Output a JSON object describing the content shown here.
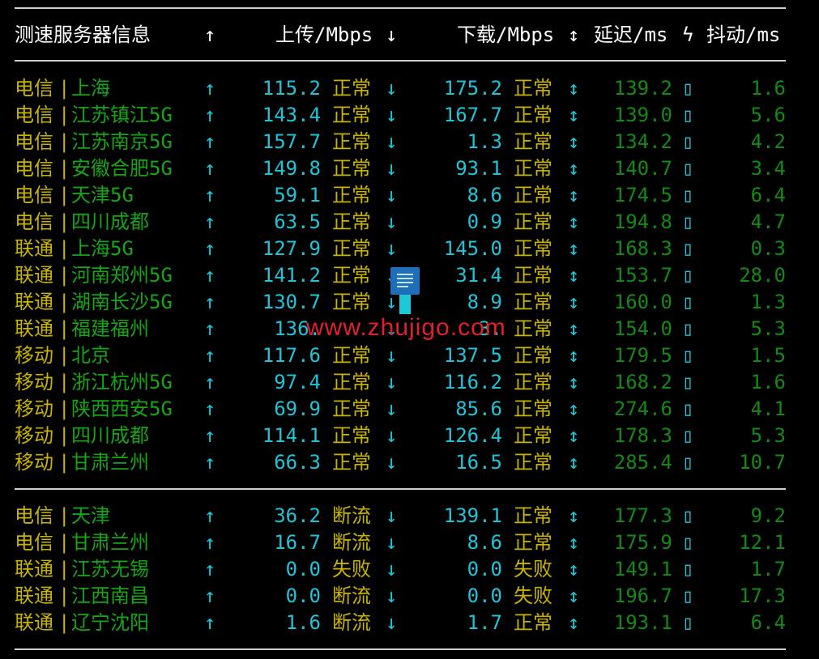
{
  "header": {
    "name": "测速服务器信息",
    "up_arrow": "↑",
    "up": "上传/Mbps",
    "down_arrow": "↓",
    "down": "下载/Mbps",
    "lat_arrow": "↕",
    "latency": "延迟/ms",
    "jitter_icon": "ϟ",
    "jitter": "抖动/ms"
  },
  "icons": {
    "up": "↑",
    "down": "↓",
    "updown": "↕",
    "jitter_box": "▯",
    "pipe": "|"
  },
  "colors": {
    "isp": "#c8b400",
    "location": "#15a515",
    "cyan": "#20c4d8",
    "green_num": "#138a13",
    "watermark": "#e0202a"
  },
  "group1": [
    {
      "isp": "电信",
      "loc": "上海",
      "up": "115.2",
      "up_status": "正常",
      "down": "175.2",
      "down_status": "正常",
      "latency": "139.2",
      "jitter": "1.6"
    },
    {
      "isp": "电信",
      "loc": "江苏镇江5G",
      "up": "143.4",
      "up_status": "正常",
      "down": "167.7",
      "down_status": "正常",
      "latency": "139.0",
      "jitter": "5.6"
    },
    {
      "isp": "电信",
      "loc": "江苏南京5G",
      "up": "157.7",
      "up_status": "正常",
      "down": "1.3",
      "down_status": "正常",
      "latency": "134.2",
      "jitter": "4.2"
    },
    {
      "isp": "电信",
      "loc": "安徽合肥5G",
      "up": "149.8",
      "up_status": "正常",
      "down": "93.1",
      "down_status": "正常",
      "latency": "140.7",
      "jitter": "3.4"
    },
    {
      "isp": "电信",
      "loc": "天津5G",
      "up": "59.1",
      "up_status": "正常",
      "down": "8.6",
      "down_status": "正常",
      "latency": "174.5",
      "jitter": "6.4"
    },
    {
      "isp": "电信",
      "loc": "四川成都",
      "up": "63.5",
      "up_status": "正常",
      "down": "0.9",
      "down_status": "正常",
      "latency": "194.8",
      "jitter": "4.7"
    },
    {
      "isp": "联通",
      "loc": "上海5G",
      "up": "127.9",
      "up_status": "正常",
      "down": "145.0",
      "down_status": "正常",
      "latency": "168.3",
      "jitter": "0.3"
    },
    {
      "isp": "联通",
      "loc": "河南郑州5G",
      "up": "141.2",
      "up_status": "正常",
      "down": "31.4",
      "down_status": "正常",
      "latency": "153.7",
      "jitter": "28.0"
    },
    {
      "isp": "联通",
      "loc": "湖南长沙5G",
      "up": "130.7",
      "up_status": "正常",
      "down": "8.9",
      "down_status": "正常",
      "latency": "160.0",
      "jitter": "1.3"
    },
    {
      "isp": "联通",
      "loc": "福建福州",
      "up": "136.",
      "up_status": "",
      "down": "3.",
      "down_status": "正常",
      "latency": "154.0",
      "jitter": "5.3"
    },
    {
      "isp": "移动",
      "loc": "北京",
      "up": "117.6",
      "up_status": "正常",
      "down": "137.5",
      "down_status": "正常",
      "latency": "179.5",
      "jitter": "1.5"
    },
    {
      "isp": "移动",
      "loc": "浙江杭州5G",
      "up": "97.4",
      "up_status": "正常",
      "down": "116.2",
      "down_status": "正常",
      "latency": "168.2",
      "jitter": "1.6"
    },
    {
      "isp": "移动",
      "loc": "陕西西安5G",
      "up": "69.9",
      "up_status": "正常",
      "down": "85.6",
      "down_status": "正常",
      "latency": "274.6",
      "jitter": "4.1"
    },
    {
      "isp": "移动",
      "loc": "四川成都",
      "up": "114.1",
      "up_status": "正常",
      "down": "126.4",
      "down_status": "正常",
      "latency": "178.3",
      "jitter": "5.3"
    },
    {
      "isp": "移动",
      "loc": "甘肃兰州",
      "up": "66.3",
      "up_status": "正常",
      "down": "16.5",
      "down_status": "正常",
      "latency": "285.4",
      "jitter": "10.7"
    }
  ],
  "group2": [
    {
      "isp": "电信",
      "loc": "天津",
      "up": "36.2",
      "up_status": "断流",
      "down": "139.1",
      "down_status": "正常",
      "latency": "177.3",
      "jitter": "9.2"
    },
    {
      "isp": "电信",
      "loc": "甘肃兰州",
      "up": "16.7",
      "up_status": "断流",
      "down": "8.6",
      "down_status": "正常",
      "latency": "175.9",
      "jitter": "12.1"
    },
    {
      "isp": "联通",
      "loc": "江苏无锡",
      "up": "0.0",
      "up_status": "失败",
      "down": "0.0",
      "down_status": "失败",
      "latency": "149.1",
      "jitter": "1.7"
    },
    {
      "isp": "联通",
      "loc": "江西南昌",
      "up": "0.0",
      "up_status": "断流",
      "down": "0.0",
      "down_status": "失败",
      "latency": "196.7",
      "jitter": "17.3"
    },
    {
      "isp": "联通",
      "loc": "辽宁沈阳",
      "up": "1.6",
      "up_status": "断流",
      "down": "1.7",
      "down_status": "正常",
      "latency": "193.1",
      "jitter": "6.4"
    }
  ],
  "watermark": {
    "text": "www.zhujigo.com"
  }
}
